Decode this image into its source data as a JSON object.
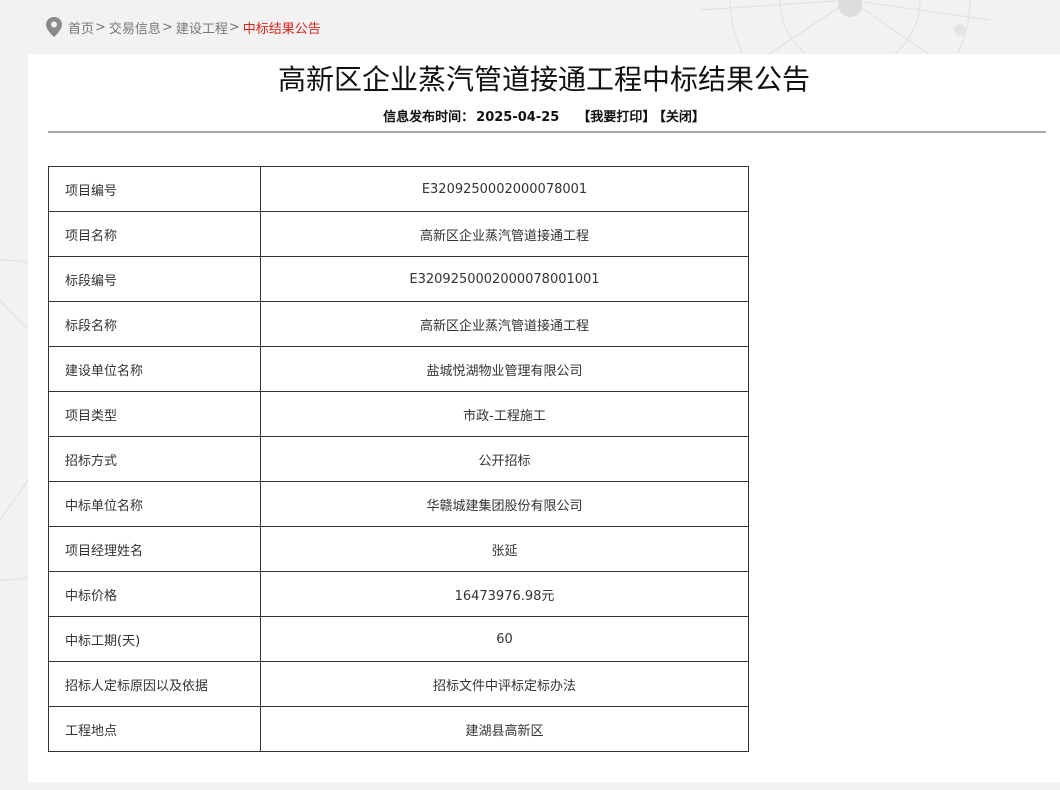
{
  "breadcrumb": {
    "items": [
      "首页",
      "交易信息",
      "建设工程"
    ],
    "separator": ">",
    "current": "中标结果公告"
  },
  "notice": {
    "title": "高新区企业蒸汽管道接通工程中标结果公告",
    "publish_label": "信息发布时间：",
    "publish_date": "2025-04-25",
    "print_label": "【我要打印】",
    "close_label": "【关闭】"
  },
  "table": {
    "rows": [
      {
        "label": "项目编号",
        "value": "E3209250002000078001"
      },
      {
        "label": "项目名称",
        "value": "高新区企业蒸汽管道接通工程"
      },
      {
        "label": "标段编号",
        "value": "E3209250002000078001001"
      },
      {
        "label": "标段名称",
        "value": "高新区企业蒸汽管道接通工程"
      },
      {
        "label": "建设单位名称",
        "value": "盐城悦湖物业管理有限公司"
      },
      {
        "label": "项目类型",
        "value": "市政-工程施工"
      },
      {
        "label": "招标方式",
        "value": "公开招标"
      },
      {
        "label": "中标单位名称",
        "value": "华赣城建集团股份有限公司"
      },
      {
        "label": "项目经理姓名",
        "value": "张延"
      },
      {
        "label": "中标价格",
        "value": "16473976.98元"
      },
      {
        "label": "中标工期(天)",
        "value": "60"
      },
      {
        "label": "招标人定标原因以及依据",
        "value": "招标文件中评标定标办法"
      },
      {
        "label": "工程地点",
        "value": "建湖县高新区"
      }
    ]
  },
  "colors": {
    "accent_red": "#d9251c",
    "page_bg": "#f2f2f2",
    "border": "#333333"
  },
  "icons": {
    "location": "location-pin-icon"
  }
}
